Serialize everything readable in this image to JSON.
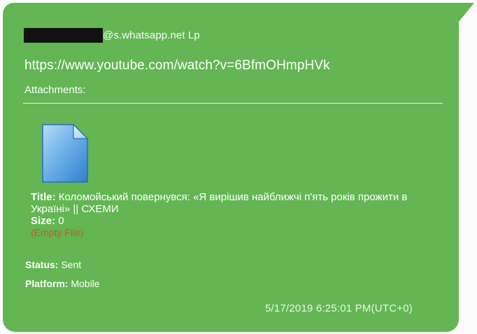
{
  "message": {
    "sender_suffix": "@s.whatsapp.net Lp",
    "url": "https://www.youtube.com/watch?v=6BfmOHmpHVk",
    "attachments_label": "Attachments:",
    "attachment": {
      "icon": "document-file-icon",
      "title_label": "Title:",
      "title_value": "Коломойський повернувся: «Я вирішив найближчі п'ять років прожити в Україні» || СХЕМИ",
      "size_label": "Size:",
      "size_value": "0",
      "empty_note": "(Empty File)"
    },
    "status_label": "Status:",
    "status_value": "Sent",
    "platform_label": "Platform:",
    "platform_value": "Mobile",
    "timestamp": "5/17/2019 6:25:01 PM(UTC+0)"
  },
  "colors": {
    "bubble": "#63b653",
    "empty_note": "#d4533a",
    "redaction": "#111111"
  }
}
